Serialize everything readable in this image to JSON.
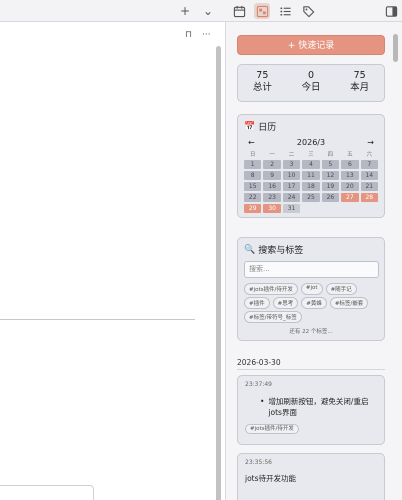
{
  "toolbar": {
    "plus": "+",
    "chevron": "⌄",
    "icons": [
      "calendar-icon",
      "jots-icon",
      "list-icon",
      "tag-icon",
      "sidebar-toggle-icon"
    ]
  },
  "left": {
    "book": "⊓",
    "more": "···"
  },
  "jots": {
    "quick_record": "+ 快速记录",
    "stats": [
      {
        "value": "75",
        "label": "总计"
      },
      {
        "value": "0",
        "label": "今日"
      },
      {
        "value": "75",
        "label": "本月"
      }
    ],
    "calendar": {
      "icon": "📅",
      "title": "日历",
      "prev": "←",
      "next": "→",
      "month": "2026/3",
      "weekdays": [
        "日",
        "一",
        "二",
        "三",
        "四",
        "五",
        "六"
      ],
      "days": [
        "1",
        "2",
        "3",
        "4",
        "5",
        "6",
        "7",
        "8",
        "9",
        "10",
        "11",
        "12",
        "13",
        "14",
        "15",
        "16",
        "17",
        "18",
        "19",
        "20",
        "21",
        "22",
        "23",
        "24",
        "25",
        "26",
        "27",
        "28",
        "29",
        "30",
        "31"
      ]
    },
    "search": {
      "icon": "🔍",
      "title": "搜索与标签",
      "placeholder": "搜索...",
      "tags": [
        "#jots插件/待开发",
        "#jot",
        "#随手记",
        "#插件",
        "#思考",
        "#黄蜂",
        "#标签/嵌套",
        "#标签/带符号_标签"
      ],
      "more": "还有 22 个标签..."
    },
    "date": "2026-03-30",
    "entries": [
      {
        "time": "23:37:49",
        "bullet": "增加刷新按钮，避免关闭/重启 jots界面",
        "tag": "#jots插件/待开发"
      },
      {
        "time": "23:35:56",
        "text": "jots待开发功能"
      }
    ]
  },
  "colors": {
    "accent": "#e49480",
    "card": "#e8e9ee"
  }
}
